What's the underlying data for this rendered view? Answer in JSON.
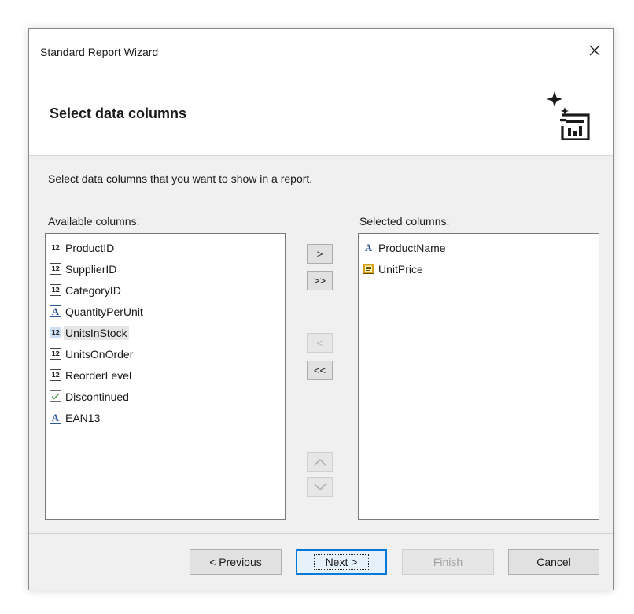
{
  "window": {
    "title": "Standard Report Wizard"
  },
  "header": {
    "page_title": "Select data columns"
  },
  "description": "Select data columns that you want to show in a report.",
  "available": {
    "label": "Available columns:",
    "items": [
      {
        "label": "ProductID",
        "icon": "number-type-icon",
        "badge": "12"
      },
      {
        "label": "SupplierID",
        "icon": "number-type-icon",
        "badge": "12"
      },
      {
        "label": "CategoryID",
        "icon": "number-type-icon",
        "badge": "12"
      },
      {
        "label": "QuantityPerUnit",
        "icon": "string-type-icon",
        "badge": "A"
      },
      {
        "label": "UnitsInStock",
        "icon": "number-type-icon",
        "badge": "12",
        "highlighted": true
      },
      {
        "label": "UnitsOnOrder",
        "icon": "number-type-icon",
        "badge": "12"
      },
      {
        "label": "ReorderLevel",
        "icon": "number-type-icon",
        "badge": "12"
      },
      {
        "label": "Discontinued",
        "icon": "boolean-type-icon"
      },
      {
        "label": "EAN13",
        "icon": "string-type-icon",
        "badge": "A"
      }
    ]
  },
  "selected": {
    "label": "Selected columns:",
    "items": [
      {
        "label": "ProductName",
        "icon": "string-type-icon",
        "badge": "A"
      },
      {
        "label": "UnitPrice",
        "icon": "currency-type-icon"
      }
    ]
  },
  "move_buttons": {
    "add": ">",
    "add_all": ">>",
    "remove": "<",
    "remove_all": "<<"
  },
  "footer": {
    "previous": "< Previous",
    "next": "Next >",
    "finish": "Finish",
    "cancel": "Cancel"
  },
  "colors": {
    "accent": "#0078d7",
    "string_icon": "#2b579a",
    "check": "#4a9a4a",
    "money": "#d4a017"
  }
}
